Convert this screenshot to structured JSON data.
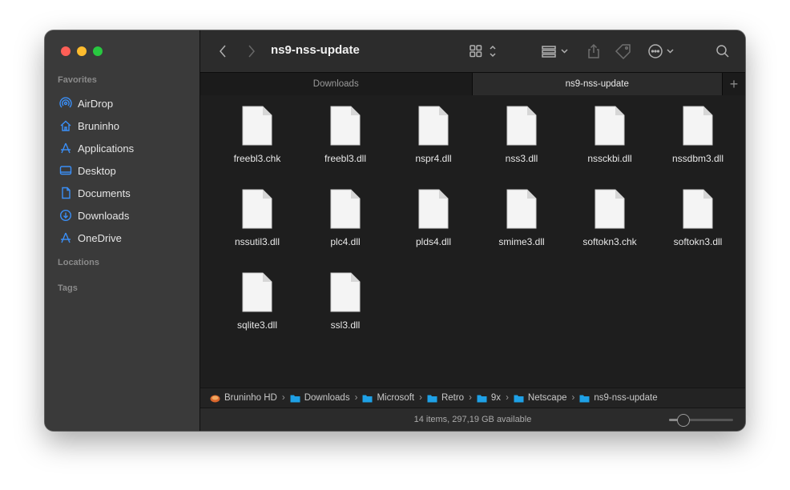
{
  "window": {
    "title": "ns9-nss-update"
  },
  "sidebar": {
    "favorites_label": "Favorites",
    "items": [
      {
        "label": "AirDrop",
        "icon": "airdrop-icon"
      },
      {
        "label": "Bruninho",
        "icon": "home-icon"
      },
      {
        "label": "Applications",
        "icon": "applications-icon"
      },
      {
        "label": "Desktop",
        "icon": "desktop-icon"
      },
      {
        "label": "Documents",
        "icon": "document-icon"
      },
      {
        "label": "Downloads",
        "icon": "download-icon"
      },
      {
        "label": "OneDrive",
        "icon": "onedrive-icon"
      }
    ],
    "locations_label": "Locations",
    "tags_label": "Tags"
  },
  "toolbar": {
    "back_icon": "chevron-left-icon",
    "forward_icon": "chevron-right-icon",
    "view_icon": "icon-grid-icon",
    "group_icon": "group-by-icon",
    "share_icon": "share-icon",
    "tag_icon": "tag-icon",
    "more_icon": "ellipsis-circle-icon",
    "search_icon": "search-icon"
  },
  "tabs": [
    {
      "label": "Downloads",
      "active": false
    },
    {
      "label": "ns9-nss-update",
      "active": true
    }
  ],
  "tab_add": "+",
  "files": [
    "freebl3.chk",
    "freebl3.dll",
    "nspr4.dll",
    "nss3.dll",
    "nssckbi.dll",
    "nssdbm3.dll",
    "nssutil3.dll",
    "plc4.dll",
    "plds4.dll",
    "smime3.dll",
    "softokn3.chk",
    "softokn3.dll",
    "sqlite3.dll",
    "ssl3.dll"
  ],
  "pathbar": [
    {
      "label": "Bruninho HD",
      "icon": "disk-icon"
    },
    {
      "label": "Downloads",
      "icon": "folder-icon"
    },
    {
      "label": "Microsoft",
      "icon": "folder-icon"
    },
    {
      "label": "Retro",
      "icon": "folder-icon"
    },
    {
      "label": "9x",
      "icon": "folder-icon"
    },
    {
      "label": "Netscape",
      "icon": "folder-icon"
    },
    {
      "label": "ns9-nss-update",
      "icon": "folder-icon"
    }
  ],
  "pathbar_separator": "›",
  "status": {
    "text": "14 items, 297,19 GB available",
    "zoom_level": 0.22
  },
  "colors": {
    "accent": "#3a8ff7",
    "folder": "#1ea0e6",
    "red": "#fe5f57",
    "yellow": "#febc2e",
    "green": "#28c840"
  }
}
